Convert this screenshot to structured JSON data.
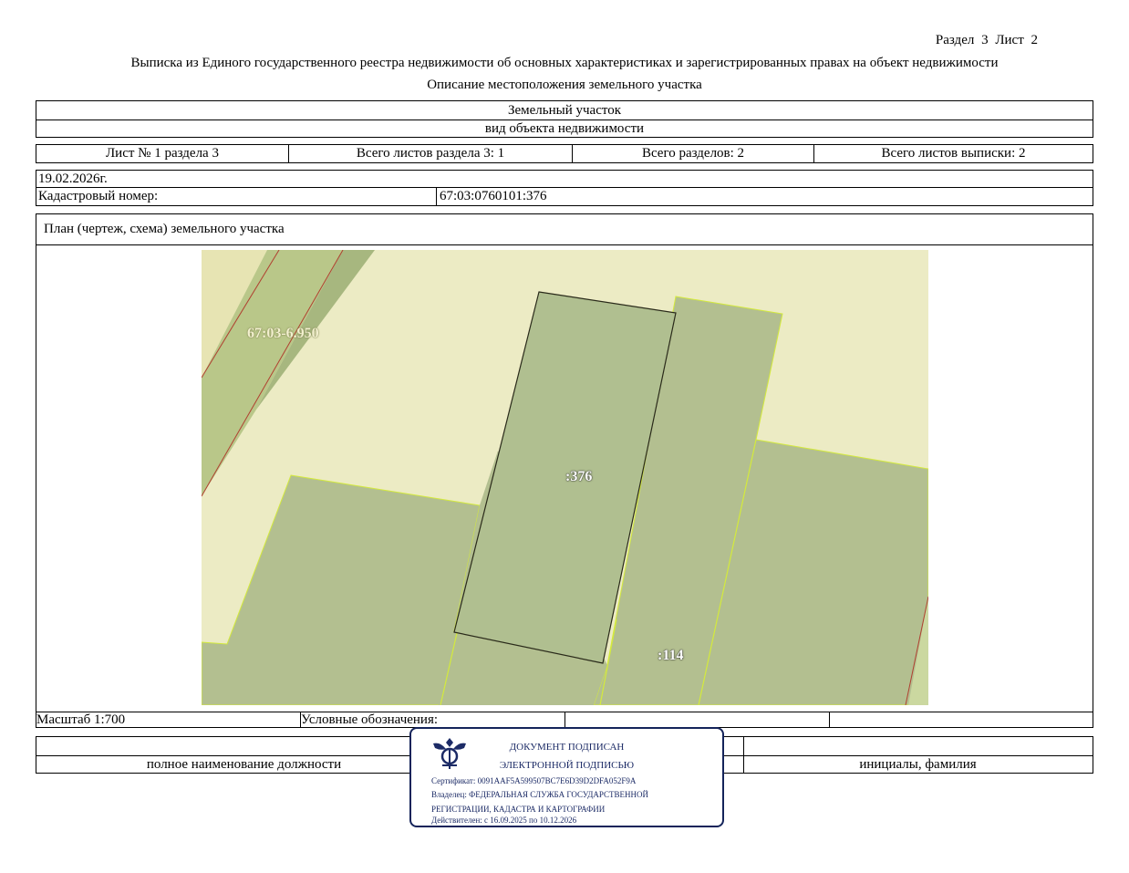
{
  "header": {
    "section_sheet": "Раздел 3    Лист 2",
    "title": "Выписка из Единого государственного реестра недвижимости об основных характеристиках и зарегистрированных правах на объект недвижимости",
    "subtitle": "Описание местоположения земельного участка"
  },
  "object": {
    "kind": "Земельный участок",
    "kind_caption": "вид объекта недвижимости"
  },
  "sheets": {
    "sheet_of_section": "Лист № 1 раздела 3",
    "total_sheets_section": "Всего листов раздела 3: 1",
    "total_sections": "Всего разделов: 2",
    "total_sheets_extract": "Всего листов выписки: 2"
  },
  "date": "19.02.2026г.",
  "cadastral": {
    "label": "Кадастровый номер:",
    "value": "67:03:0760101:376"
  },
  "plan": {
    "title": "План (чертеж, схема) земельного участка",
    "labels": {
      "quarter": "67:03-6.950",
      "parcel_main": ":376",
      "parcel_neighbor": ":114"
    }
  },
  "legend": {
    "scale": "Масштаб 1:700",
    "legend_label": "Условные обозначения:"
  },
  "signature_row": {
    "position_caption": "полное наименование должности",
    "name_caption": "инициалы, фамилия"
  },
  "stamp": {
    "line1": "ДОКУМЕНТ ПОДПИСАН",
    "line2": "ЭЛЕКТРОННОЙ ПОДПИСЬЮ",
    "certificate": "Сертификат: 0091AAF5A599507BC7E6D39D2DFA052F9A",
    "owner_1": "Владелец: ФЕДЕРАЛЬНАЯ СЛУЖБА ГОСУДАРСТВЕННОЙ",
    "owner_2": "РЕГИСТРАЦИИ, КАДАСТРА И КАРТОГРАФИИ",
    "valid": "Действителен: с 16.09.2025 по 10.12.2026"
  },
  "colors": {
    "map_background": "#ecebc4",
    "parcel_fill": "#b3bf90",
    "strip_fill": "#b9c789",
    "border_green": "#d4ea3c",
    "stamp_blue": "#14235a"
  }
}
